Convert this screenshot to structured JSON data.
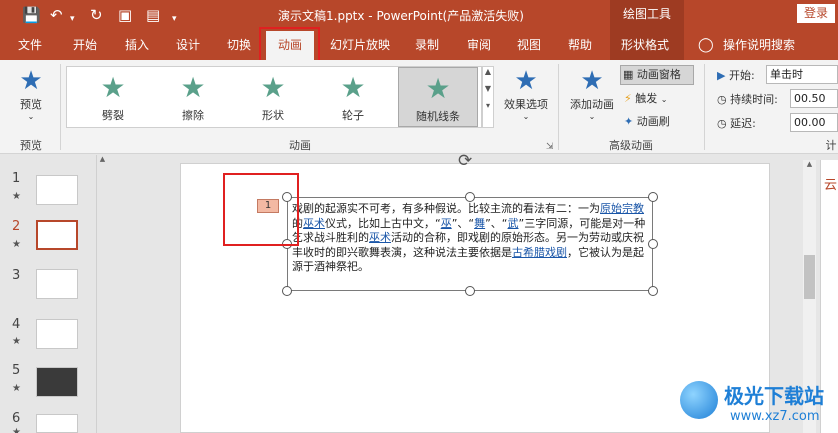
{
  "titlebar": {
    "document_title": "演示文稿1.pptx  -  PowerPoint(产品激活失败)",
    "context_tab": "绘图工具",
    "login_label": "登录",
    "quick_access": [
      "save-icon",
      "undo-icon",
      "redo-icon",
      "present-icon",
      "preview-icon",
      "dropdown-icon"
    ]
  },
  "menu": {
    "tabs": [
      {
        "label": "文件"
      },
      {
        "label": "开始"
      },
      {
        "label": "插入"
      },
      {
        "label": "设计"
      },
      {
        "label": "切换"
      },
      {
        "label": "动画"
      },
      {
        "label": "幻灯片放映"
      },
      {
        "label": "录制"
      },
      {
        "label": "审阅"
      },
      {
        "label": "视图"
      },
      {
        "label": "帮助"
      },
      {
        "label": "形状格式"
      }
    ],
    "active_tab": "动画",
    "tell_me": "操作说明搜索"
  },
  "ribbon": {
    "preview": {
      "label": "预览",
      "group": "预览"
    },
    "animation_group": "动画",
    "animations": [
      {
        "label": "劈裂"
      },
      {
        "label": "擦除"
      },
      {
        "label": "形状"
      },
      {
        "label": "轮子"
      },
      {
        "label": "随机线条"
      }
    ],
    "selected_animation": "随机线条",
    "effect_options": "效果选项",
    "advanced": {
      "group": "高级动画",
      "add_animation": "添加动画",
      "animation_pane": "动画窗格",
      "trigger": "触发",
      "animation_painter": "动画刷"
    },
    "timing": {
      "start_label": "开始:",
      "start_value": "单击时",
      "duration_label": "持续时间:",
      "duration_value": "00.50",
      "delay_label": "延迟:",
      "delay_value": "00.00",
      "group_partial": "计"
    }
  },
  "slides_panel": {
    "items": [
      {
        "num": "1",
        "star": "★"
      },
      {
        "num": "2",
        "star": "★"
      },
      {
        "num": "3",
        "star": ""
      },
      {
        "num": "4",
        "star": "★"
      },
      {
        "num": "5",
        "star": "★"
      },
      {
        "num": "6",
        "star": "★"
      }
    ],
    "active": "2"
  },
  "slide": {
    "anim_tag": "1",
    "text_parts": {
      "p1": "戏剧的起源实不可考，有多种假说。比较主流的看法有二：一为",
      "l1": "原始宗教",
      "p2": "的",
      "l2": "巫术",
      "p3": "仪式，比如上古中文，“",
      "l3": "巫",
      "p4": "”、“",
      "l4": "舞",
      "p5": "”、“",
      "l5": "武",
      "p6": "”三字同源，可能是对一种乞求战斗胜利的",
      "l6": "巫术",
      "p7": "活动的合称，即戏剧的原始形态。另一为劳动或庆祝丰收时的即兴歌舞表演，这种说法主要依据是",
      "l7": "古希腊戏剧",
      "p8": "，它被认为是起源于酒神祭祀。"
    }
  },
  "right_panel": {
    "partial_label": "云"
  },
  "watermark": {
    "line1": "极光下载站",
    "line2": "www.xz7.com"
  },
  "colors": {
    "brand": "#b7472a",
    "highlight": "#e02020",
    "link": "#1a56a8"
  }
}
